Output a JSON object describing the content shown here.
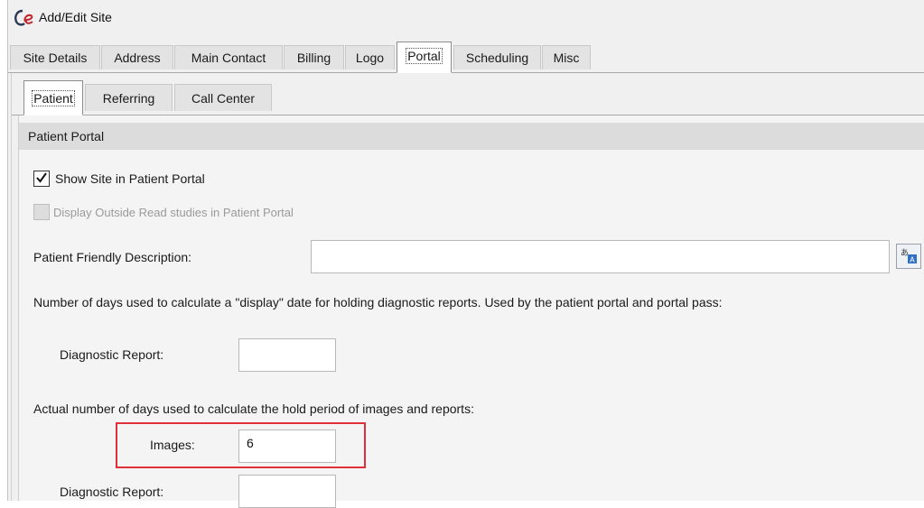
{
  "window": {
    "title": "Add/Edit Site"
  },
  "main_tabs": [
    {
      "label": "Site Details"
    },
    {
      "label": "Address"
    },
    {
      "label": "Main Contact"
    },
    {
      "label": "Billing"
    },
    {
      "label": "Logo"
    },
    {
      "label": "Portal"
    },
    {
      "label": "Scheduling"
    },
    {
      "label": "Misc"
    }
  ],
  "active_main_tab": "Portal",
  "sub_tabs": [
    {
      "label": "Patient"
    },
    {
      "label": "Referring"
    },
    {
      "label": "Call Center"
    }
  ],
  "active_sub_tab": "Patient",
  "patient_portal": {
    "header": "Patient Portal",
    "show_site": {
      "label": "Show Site in Patient Portal",
      "checked": true
    },
    "display_outside_read": {
      "label": "Display Outside Read studies in Patient Portal",
      "checked": false,
      "disabled": true
    },
    "friendly_description": {
      "label": "Patient Friendly Description:",
      "value": ""
    },
    "display_days_text": "Number of days used to calculate a \"display\" date for holding diagnostic reports.  Used by the patient portal and portal pass:",
    "display_diagnostic_report": {
      "label": "Diagnostic Report:",
      "value": ""
    },
    "hold_days_text": "Actual number of days used to calculate the hold period of images and reports:",
    "hold_images": {
      "label": "Images:",
      "value": "6"
    },
    "hold_diagnostic_report": {
      "label": "Diagnostic Report:",
      "value": ""
    }
  },
  "colors": {
    "highlight": "#e0303a",
    "active_tab": "#ffffff",
    "background": "#f0f0f0"
  }
}
